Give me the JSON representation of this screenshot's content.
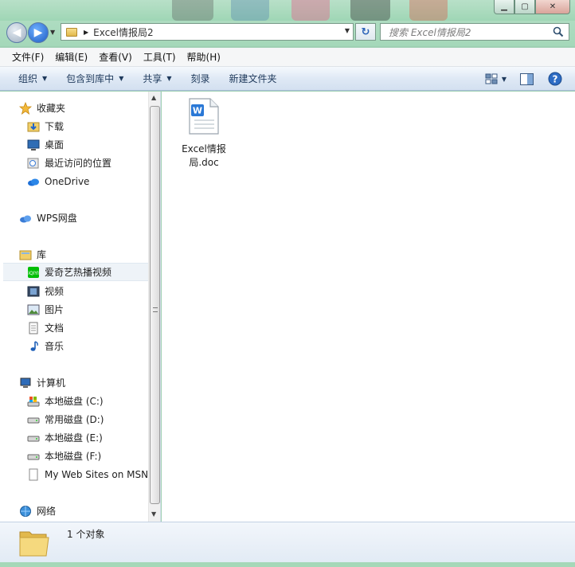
{
  "window": {
    "minimize_icon": "minimize-icon",
    "maximize_icon": "maximize-icon",
    "close_icon": "close-icon"
  },
  "address": {
    "path": "Excel情报局2",
    "search_placeholder": "搜索 Excel情报局2"
  },
  "menu": {
    "items": [
      "文件(F)",
      "编辑(E)",
      "查看(V)",
      "工具(T)",
      "帮助(H)"
    ]
  },
  "toolbar": {
    "organize": "组织",
    "include_library": "包含到库中",
    "share": "共享",
    "burn": "刻录",
    "new_folder": "新建文件夹"
  },
  "nav": {
    "favorites": "收藏夹",
    "downloads": "下载",
    "desktop": "桌面",
    "recent": "最近访问的位置",
    "onedrive": "OneDrive",
    "wps": "WPS网盘",
    "libraries": "库",
    "iqiyi": "爱奇艺热播视频",
    "videos": "视频",
    "pictures": "图片",
    "documents": "文档",
    "music": "音乐",
    "computer": "计算机",
    "drive_c": "本地磁盘 (C:)",
    "drive_d": "常用磁盘 (D:)",
    "drive_e": "本地磁盘 (E:)",
    "drive_f": "本地磁盘 (F:)",
    "msn": "My Web Sites on MSN",
    "network": "网络"
  },
  "content": {
    "file_name_line1": "Excel情报",
    "file_name_line2": "局.doc"
  },
  "details": {
    "count": "1 个对象"
  },
  "colors": {
    "glass": "#a4d8b9",
    "toolbar_text": "#1e395b",
    "selection": "#eef3f8",
    "wps_blue": "#3a7bd5"
  }
}
